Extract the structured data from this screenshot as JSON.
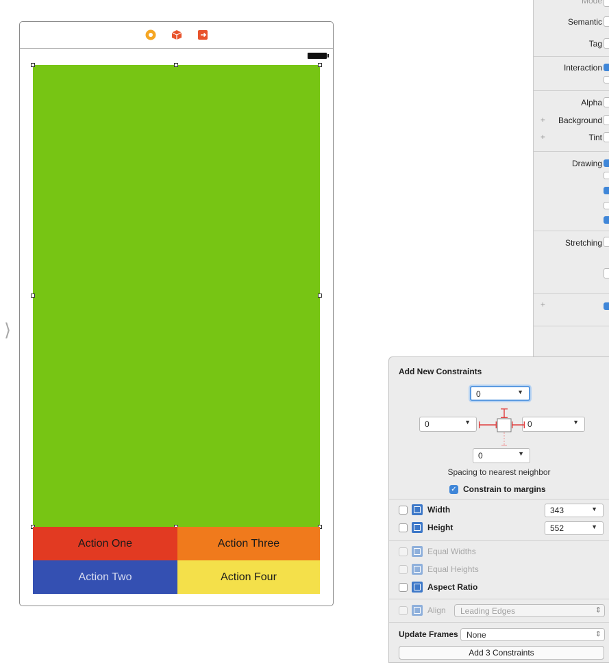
{
  "scene": {
    "actions": [
      {
        "label": "Action One",
        "color": "#e23a22"
      },
      {
        "label": "Action Three",
        "color": "#f07a1c"
      },
      {
        "label": "Action Two",
        "color": "#3450b2"
      },
      {
        "label": "Action Four",
        "color": "#f4e04a"
      }
    ],
    "main_view_color": "#77c514",
    "dock_icons": [
      "view-controller-icon",
      "first-responder-icon",
      "exit-icon"
    ],
    "entry_point_icon": "entry-arrow-icon"
  },
  "inspector": {
    "mode_label": "Mode",
    "semantic_label": "Semantic",
    "tag_label": "Tag",
    "interaction_label": "Interaction",
    "alpha_label": "Alpha",
    "background_label": "Background",
    "tint_label": "Tint",
    "drawing_label": "Drawing",
    "stretching_label": "Stretching",
    "plus": "+"
  },
  "constraints": {
    "title": "Add New Constraints",
    "top": "0",
    "leading": "0",
    "trailing": "0",
    "bottom": "0",
    "spacing_text": "Spacing to nearest neighbor",
    "margins_label": "Constrain to margins",
    "margins_checked": true,
    "width_label": "Width",
    "width_value": "343",
    "height_label": "Height",
    "height_value": "552",
    "equal_widths_label": "Equal Widths",
    "equal_heights_label": "Equal Heights",
    "aspect_ratio_label": "Aspect Ratio",
    "align_label": "Align",
    "align_value": "Leading Edges",
    "update_frames_label": "Update Frames",
    "update_frames_value": "None",
    "add_button_label": "Add 3 Constraints"
  }
}
